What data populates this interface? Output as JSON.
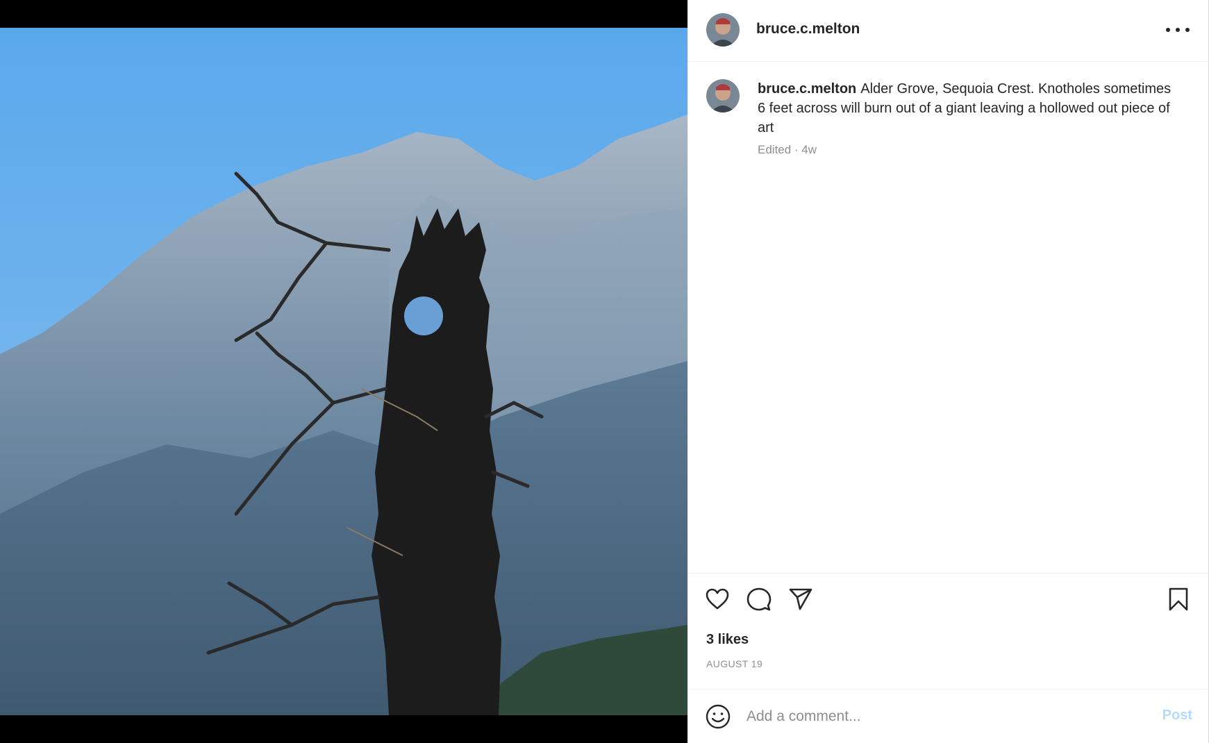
{
  "post": {
    "author": "bruce.c.melton",
    "caption_user": "bruce.c.melton",
    "caption_text": "Alder Grove, Sequoia Crest. Knotholes sometimes 6 feet across will burn out of a giant leaving a hollowed out piece of art",
    "meta": "Edited · 4w",
    "likes": "3 likes",
    "date": "AUGUST 19"
  },
  "comment": {
    "placeholder": "Add a comment...",
    "post_label": "Post"
  },
  "icons": {
    "more": "more-options-icon",
    "like": "heart-icon",
    "comment": "comment-icon",
    "share": "share-icon",
    "save": "bookmark-icon",
    "emoji": "emoji-icon"
  },
  "colors": {
    "text": "#262626",
    "secondary": "#8e8e8e",
    "post_button_disabled": "#b3dbff",
    "border": "#efefef"
  }
}
